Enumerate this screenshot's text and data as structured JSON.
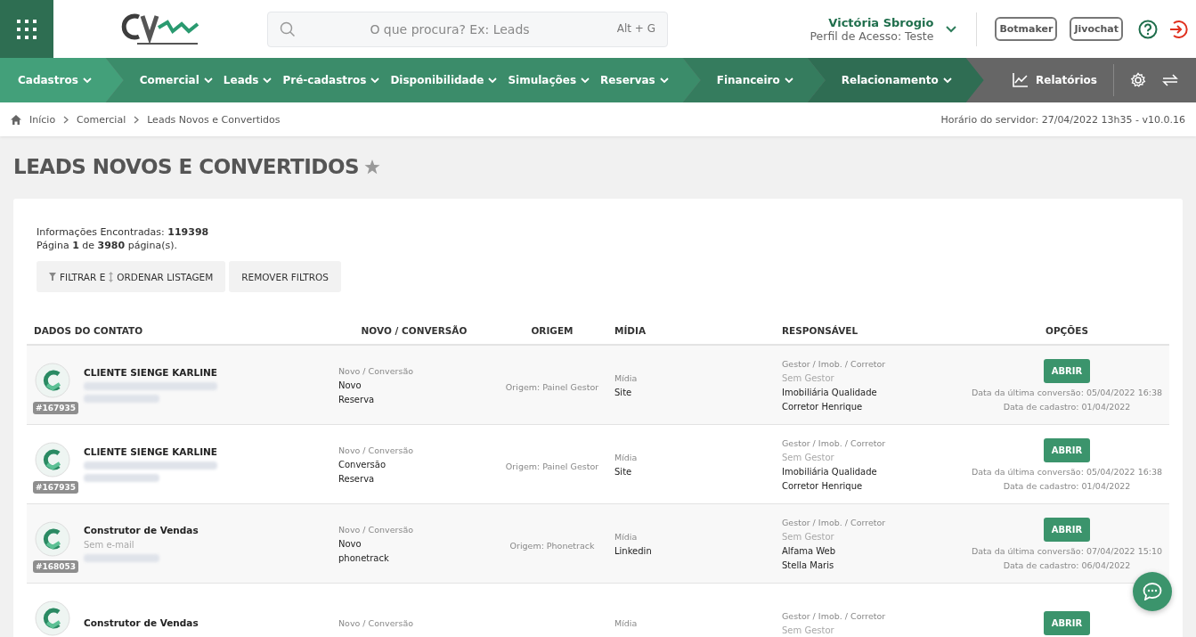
{
  "header": {
    "search": {
      "placeholder": "O que procura? Ex: Leads",
      "shortcut": "Alt + G"
    },
    "user": {
      "name": "Victória Sbrogio",
      "profile": "Perfil de Acesso: Teste"
    },
    "buttons": [
      "Botmaker",
      "Jivochat"
    ]
  },
  "nav": {
    "groups": [
      {
        "color": "#43a07a",
        "items": [
          "Cadastros"
        ]
      },
      {
        "color": "#3b8c6a",
        "items": [
          "Comercial",
          "Leads",
          "Pré-cadastros",
          "Disponibilidade",
          "Simulações",
          "Reservas"
        ]
      },
      {
        "color": "#357c5e",
        "items": [
          "Financeiro"
        ]
      },
      {
        "color": "#2f6d53",
        "items": [
          "Relacionamento"
        ]
      }
    ],
    "reports": "Relatórios"
  },
  "breadcrumb": [
    "Início",
    "Comercial",
    "Leads Novos e Convertidos"
  ],
  "server_time": "Horário do servidor: 27/04/2022 13h35 - v10.0.16",
  "page_title": "LEADS NOVOS E CONVERTIDOS",
  "summary": {
    "found": "Informações Encontradas: **119398**",
    "pages": "Página **1** de **3980** página(s)."
  },
  "actions": [
    "FILTRAR E",
    "ORDENAR LISTAGEM",
    "REMOVER FILTROS"
  ],
  "table": {
    "columns": [
      "DADOS DO CONTATO",
      "NOVO / CONVERSÃO",
      "ORIGEM",
      "MÍDIA",
      "RESPONSÁVEL",
      "OPÇÕES"
    ],
    "rows": [
      {
        "name": "CLIENTE SIENGE KARLINE",
        "email_redacted": true,
        "phone_redacted": true,
        "id": "#167935",
        "type_label": "Novo / Conversão",
        "type": "Novo",
        "stage": "Reserva",
        "origin": "Origem: Painel Gestor",
        "media_label": "Mídia",
        "media": "Site",
        "resp_label": "Gestor / Imob. / Corretor",
        "manager": "Sem Gestor",
        "agency": "Imobiliária Qualidade",
        "broker": "Corretor Henrique",
        "button": "ABRIR",
        "last_conversion": "Data da última conversão: 05/04/2022 16:38",
        "created": "Data de cadastro: 01/04/2022"
      },
      {
        "name": "CLIENTE SIENGE KARLINE",
        "email_redacted": true,
        "phone_redacted": true,
        "id": "#167935",
        "type_label": "Novo / Conversão",
        "type": "Conversão",
        "stage": "Reserva",
        "origin": "Origem: Painel Gestor",
        "media_label": "Mídia",
        "media": "Site",
        "resp_label": "Gestor / Imob. / Corretor",
        "manager": "Sem Gestor",
        "agency": "Imobiliária Qualidade",
        "broker": "Corretor Henrique",
        "button": "ABRIR",
        "last_conversion": "Data da última conversão: 05/04/2022 16:38",
        "created": "Data de cadastro: 01/04/2022"
      },
      {
        "name": "Construtor de Vendas",
        "email": "Sem e-mail",
        "phone_redacted": true,
        "id": "#168053",
        "type_label": "Novo / Conversão",
        "type": "Novo",
        "stage": "phonetrack",
        "origin": "Origem: Phonetrack",
        "media_label": "Mídia",
        "media": "Linkedin",
        "resp_label": "Gestor / Imob. / Corretor",
        "manager": "Sem Gestor",
        "agency": "Alfama Web",
        "broker": "Stella Maris",
        "button": "ABRIR",
        "last_conversion": "Data da última conversão: 07/04/2022 15:10",
        "created": "Data de cadastro: 06/04/2022"
      },
      {
        "name": "Construtor de Vendas",
        "type_label": "Novo / Conversão",
        "media_label": "Mídia",
        "resp_label": "Gestor / Imob. / Corretor",
        "manager": "Sem Gestor",
        "button": "ABRIR"
      }
    ]
  }
}
